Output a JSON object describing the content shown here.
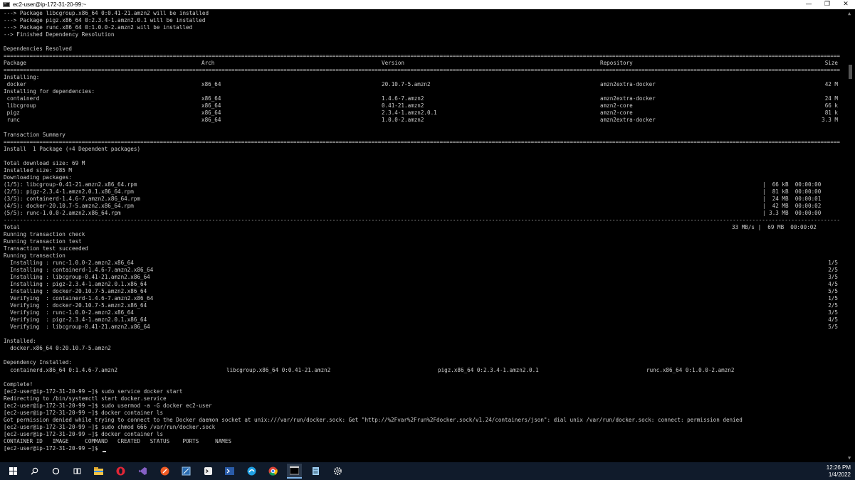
{
  "window": {
    "title": "ec2-user@ip-172-31-20-99:~",
    "minimize": "—",
    "maximize": "❐",
    "close": "✕"
  },
  "top_lines": [
    "---> Package libcgroup.x86_64 0:0.41-21.amzn2 will be installed",
    "---> Package pigz.x86_64 0:2.3.4-1.amzn2.0.1 will be installed",
    "---> Package runc.x86_64 0:1.0.0-2.amzn2 will be installed",
    "--> Finished Dependency Resolution",
    "",
    "Dependencies Resolved"
  ],
  "pkg_table": {
    "headers": [
      "Package",
      "Arch",
      "Version",
      "Repository",
      "Size"
    ],
    "installing_label": "Installing:",
    "main_rows": [
      {
        "package": " docker",
        "arch": "x86_64",
        "version": "20.10.7-5.amzn2",
        "repo": "amzn2extra-docker",
        "size": "42 M"
      }
    ],
    "deps_label": "Installing for dependencies:",
    "dep_rows": [
      {
        "package": " containerd",
        "arch": "x86_64",
        "version": "1.4.6-7.amzn2",
        "repo": "amzn2extra-docker",
        "size": "24 M"
      },
      {
        "package": " libcgroup",
        "arch": "x86_64",
        "version": "0.41-21.amzn2",
        "repo": "amzn2-core",
        "size": "66 k"
      },
      {
        "package": " pigz",
        "arch": "x86_64",
        "version": "2.3.4-1.amzn2.0.1",
        "repo": "amzn2-core",
        "size": "81 k"
      },
      {
        "package": " runc",
        "arch": "x86_64",
        "version": "1.0.0-2.amzn2",
        "repo": "amzn2extra-docker",
        "size": "3.3 M"
      }
    ]
  },
  "summary": {
    "title": "Transaction Summary",
    "install_line": "Install  1 Package (+4 Dependent packages)",
    "download_size": "Total download size: 69 M",
    "installed_size": "Installed size: 285 M",
    "downloading": "Downloading packages:"
  },
  "downloads": [
    {
      "file": "(1/5): libcgroup-0.41-21.amzn2.x86_64.rpm",
      "size": "|  66 kB  00:00:00"
    },
    {
      "file": "(2/5): pigz-2.3.4-1.amzn2.0.1.x86_64.rpm",
      "size": "|  81 kB  00:00:00"
    },
    {
      "file": "(3/5): containerd-1.4.6-7.amzn2.x86_64.rpm",
      "size": "|  24 MB  00:00:01"
    },
    {
      "file": "(4/5): docker-20.10.7-5.amzn2.x86_64.rpm",
      "size": "|  42 MB  00:00:02"
    },
    {
      "file": "(5/5): runc-1.0.0-2.amzn2.x86_64.rpm",
      "size": "| 3.3 MB  00:00:00"
    }
  ],
  "total": {
    "label": "Total",
    "value": "33 MB/s |  69 MB  00:00:02"
  },
  "transaction_lines": [
    "Running transaction check",
    "Running transaction test",
    "Transaction test succeeded",
    "Running transaction"
  ],
  "steps": [
    {
      "text": "  Installing : runc-1.0.0-2.amzn2.x86_64",
      "progress": "1/5"
    },
    {
      "text": "  Installing : containerd-1.4.6-7.amzn2.x86_64",
      "progress": "2/5"
    },
    {
      "text": "  Installing : libcgroup-0.41-21.amzn2.x86_64",
      "progress": "3/5"
    },
    {
      "text": "  Installing : pigz-2.3.4-1.amzn2.0.1.x86_64",
      "progress": "4/5"
    },
    {
      "text": "  Installing : docker-20.10.7-5.amzn2.x86_64",
      "progress": "5/5"
    },
    {
      "text": "  Verifying  : containerd-1.4.6-7.amzn2.x86_64",
      "progress": "1/5"
    },
    {
      "text": "  Verifying  : docker-20.10.7-5.amzn2.x86_64",
      "progress": "2/5"
    },
    {
      "text": "  Verifying  : runc-1.0.0-2.amzn2.x86_64",
      "progress": "3/5"
    },
    {
      "text": "  Verifying  : pigz-2.3.4-1.amzn2.0.1.x86_64",
      "progress": "4/5"
    },
    {
      "text": "  Verifying  : libcgroup-0.41-21.amzn2.x86_64",
      "progress": "5/5"
    }
  ],
  "installed": {
    "label": "Installed:",
    "item": "  docker.x86_64 0:20.10.7-5.amzn2"
  },
  "dep_installed": {
    "label": "Dependency Installed:",
    "items": [
      "  containerd.x86_64 0:1.4.6-7.amzn2",
      "libcgroup.x86_64 0:0.41-21.amzn2",
      "pigz.x86_64 0:2.3.4-1.amzn2.0.1",
      "runc.x86_64 0:1.0.0-2.amzn2"
    ]
  },
  "session": [
    "Complete!",
    "[ec2-user@ip-172-31-20-99 ~]$ sudo service docker start",
    "Redirecting to /bin/systemctl start docker.service",
    "[ec2-user@ip-172-31-20-99 ~]$ sudo usermod -a -G docker ec2-user",
    "[ec2-user@ip-172-31-20-99 ~]$ docker container ls",
    "Got permission denied while trying to connect to the Docker daemon socket at unix:///var/run/docker.sock: Get \"http://%2Fvar%2Frun%2Fdocker.sock/v1.24/containers/json\": dial unix /var/run/docker.sock: connect: permission denied",
    "[ec2-user@ip-172-31-20-99 ~]$ sudo chmod 666 /var/run/docker.sock",
    "[ec2-user@ip-172-31-20-99 ~]$ docker container ls",
    "CONTAINER ID   IMAGE     COMMAND   CREATED   STATUS    PORTS     NAMES",
    "[ec2-user@ip-172-31-20-99 ~]$ "
  ],
  "taskbar": {
    "icons": [
      "windows-start-icon",
      "search-icon",
      "cortana-icon",
      "task-view-icon",
      "file-explorer-icon",
      "opera-icon",
      "visual-studio-icon",
      "postman-icon",
      "remote-desktop-icon",
      "terminal-app-icon",
      "powershell-icon",
      "edge-icon",
      "chrome-icon",
      "cmd-icon",
      "notepad-icon",
      "settings-icon"
    ],
    "time": "12:26 PM",
    "date": "1/4/2022"
  }
}
